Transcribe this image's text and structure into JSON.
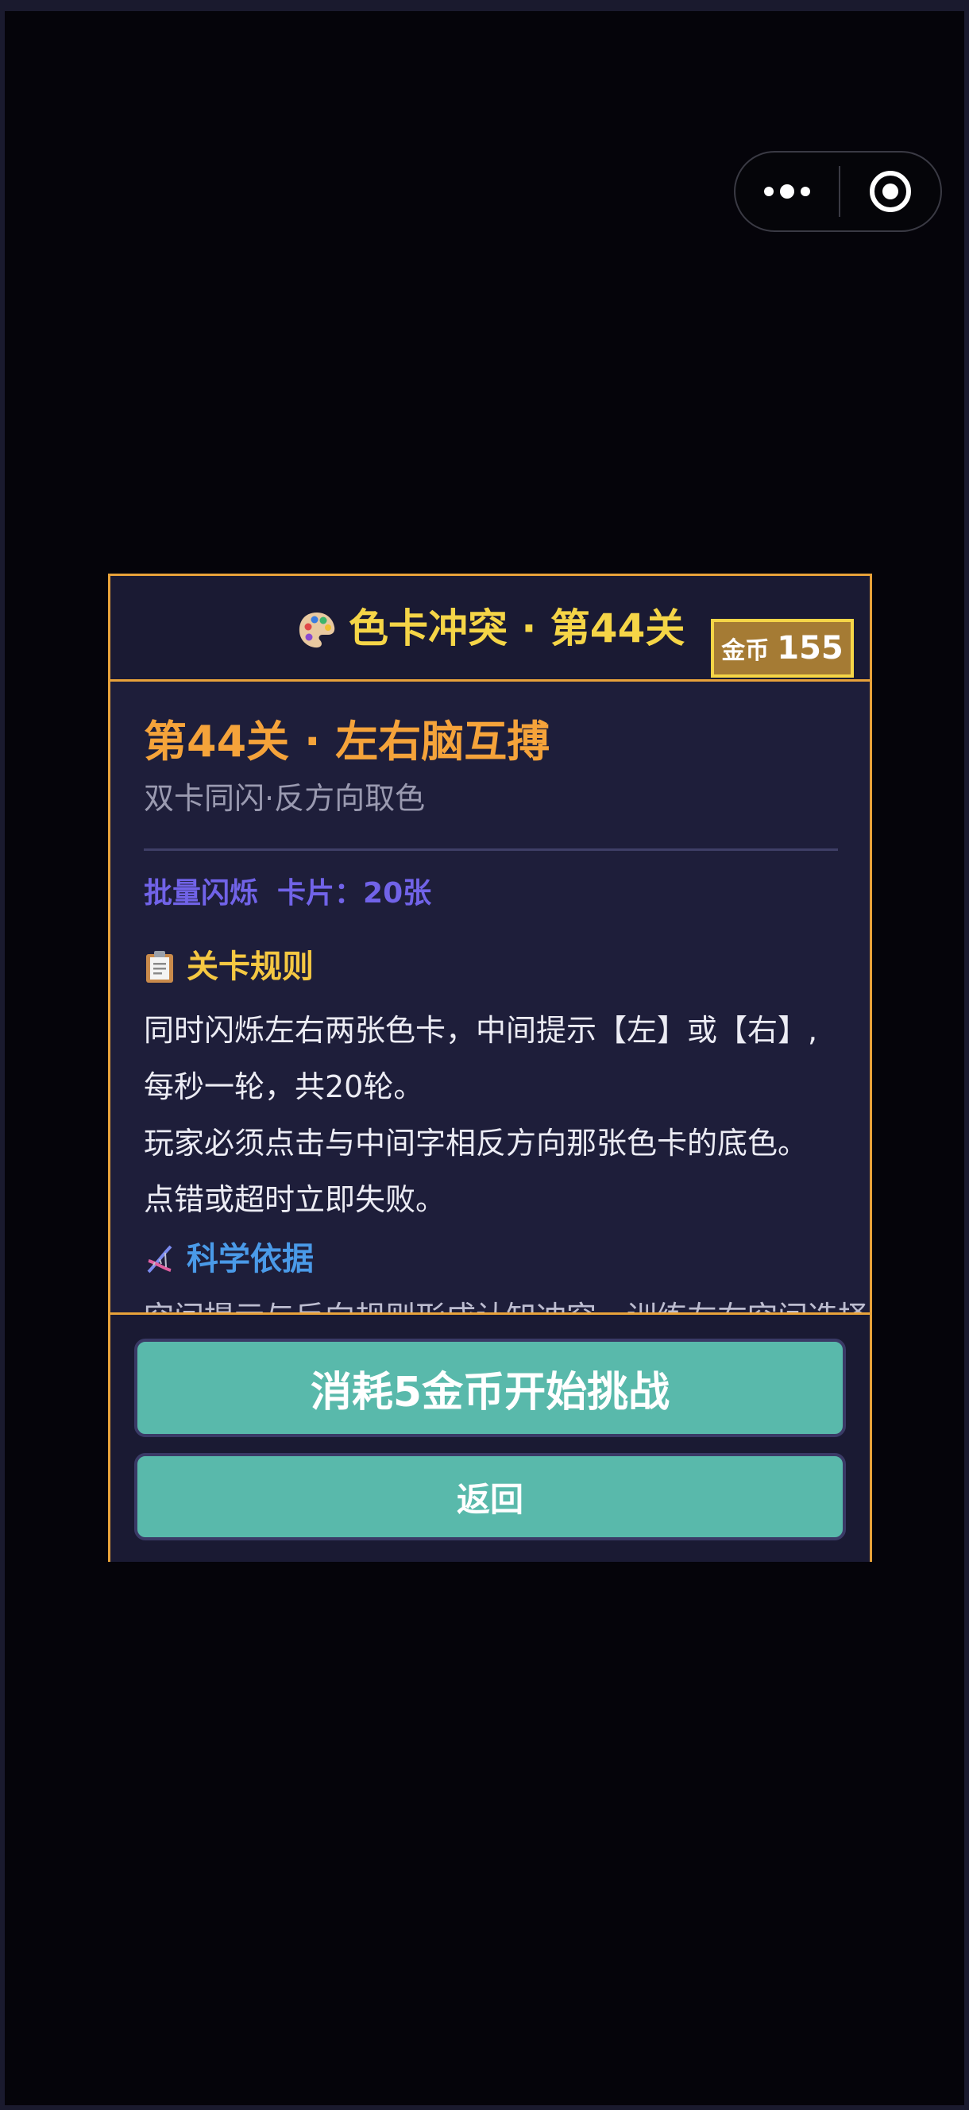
{
  "capsule": {
    "more_icon": "more-dots-icon",
    "close_icon": "target-close-icon"
  },
  "header": {
    "icon": "palette-icon",
    "title": "色卡冲突 · 第44关",
    "coin_label": "金币",
    "coin_value": "155"
  },
  "level": {
    "heading": "第44关 · 左右脑互搏",
    "subtitle": "双卡同闪·反方向取色",
    "mode": "批量闪烁",
    "cards": "卡片：20张"
  },
  "rules": {
    "icon": "clipboard-icon",
    "title": "关卡规则",
    "lines": [
      "同时闪烁左右两张色卡，中间提示【左】或【右】,",
      "每秒一轮，共20轮。",
      "玩家必须点击与中间字相反方向那张色卡的底色。",
      "点错或超时立即失败。"
    ]
  },
  "science": {
    "icon": "dna-icon",
    "title": "科学依据",
    "text": "空间提示与反向规则形成认知冲突，训练左右空间选择"
  },
  "buttons": {
    "start": "消耗5金币开始挑战",
    "back": "返回"
  },
  "colors": {
    "accent": "#e8a23a",
    "title_yellow": "#f5d547",
    "heading_orange": "#f5a33a",
    "meta_purple": "#7163e8",
    "science_blue": "#4a9ae8",
    "button_teal": "#59b9ab"
  }
}
